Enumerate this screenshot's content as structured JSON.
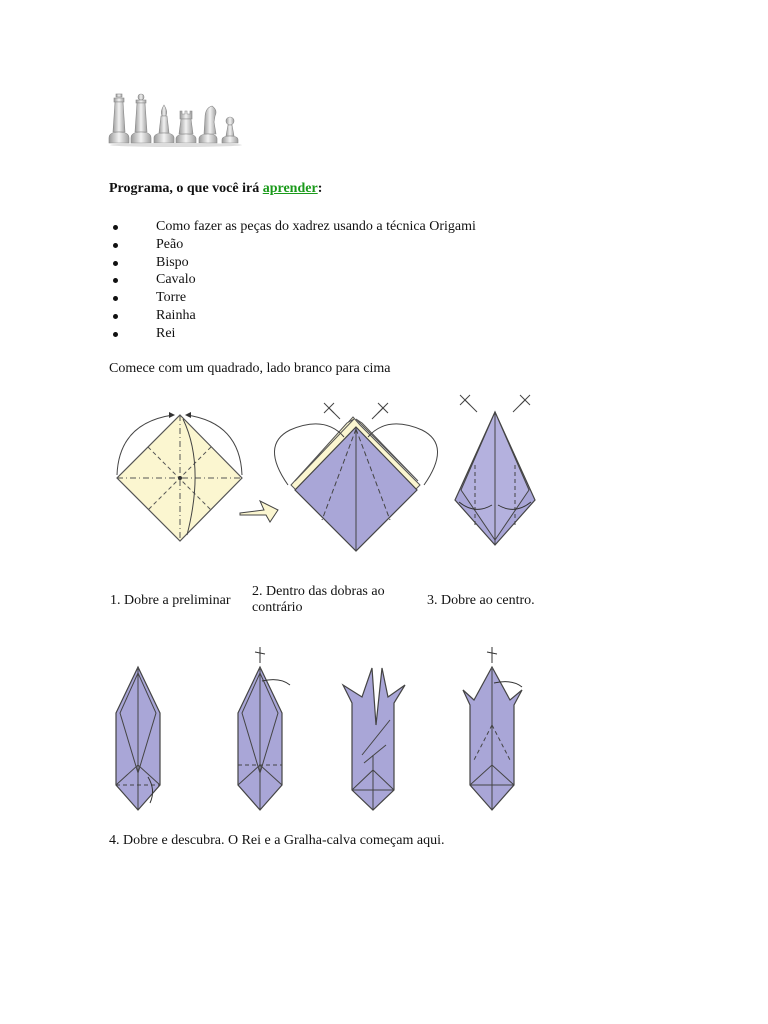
{
  "header": {
    "chess_image": "chess-pieces-icon",
    "title_prefix": "Programa, o que você irá ",
    "title_link": "aprender",
    "title_suffix": ":",
    "link_color": "#1a9a1a"
  },
  "list": {
    "items": [
      "Como fazer as peças do xadrez usando a técnica Origami",
      "Peão",
      "Bispo",
      "Cavalo",
      "Torre",
      "Rainha",
      "Rei"
    ]
  },
  "intro": "Comece com um quadrado, lado branco para cima",
  "steps": {
    "step1": "1. Dobre a preliminar",
    "step2": "2. Dentro das dobras ao contrário",
    "step3": "3. Dobre ao centro.",
    "step4": "4. Dobre e descubra. O Rei e a Gralha-calva começam aqui."
  },
  "colors": {
    "paper_white_side": "#fbf6d0",
    "paper_colored_side": "#aaa6d6",
    "line": "#333333"
  }
}
